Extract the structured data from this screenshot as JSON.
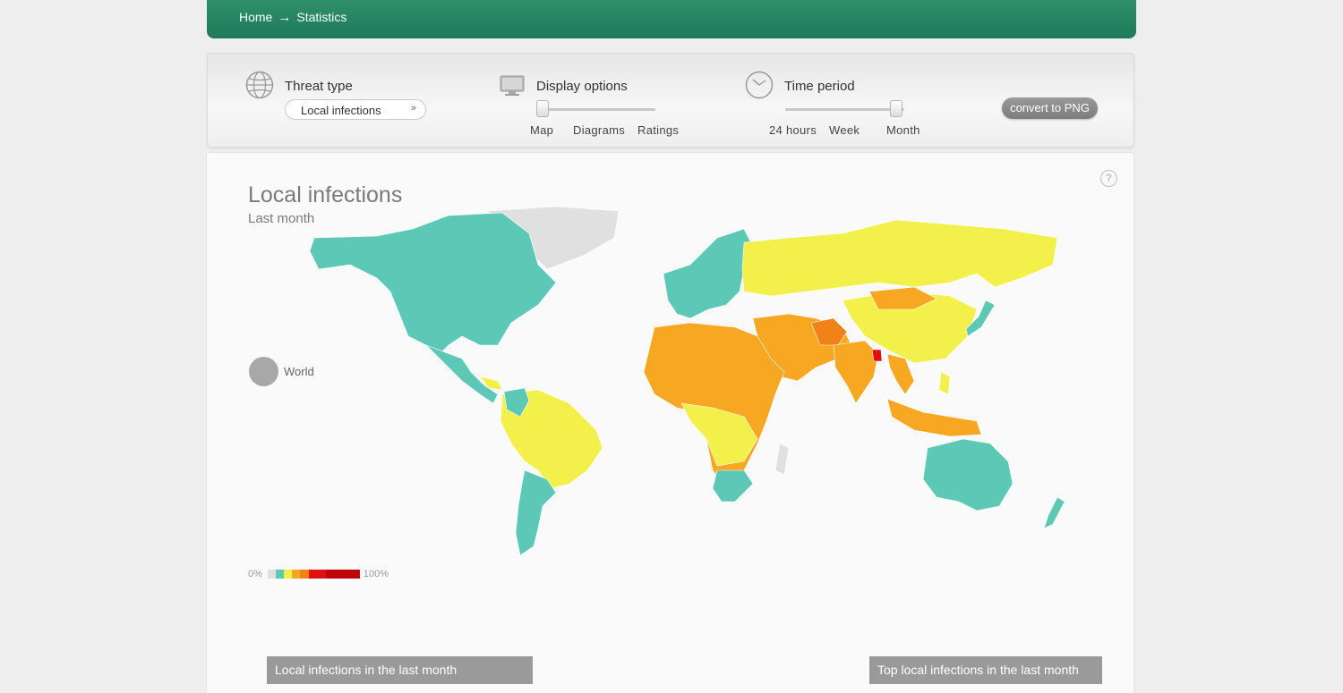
{
  "breadcrumb": {
    "home": "Home",
    "arrow": "→",
    "current": "Statistics"
  },
  "controls": {
    "threat_type": {
      "title": "Threat type",
      "selected": "Local infections",
      "icon": "globe-icon"
    },
    "display_options": {
      "title": "Display options",
      "icon": "monitor-icon",
      "options": [
        "Map",
        "Diagrams",
        "Ratings"
      ],
      "selected": "Map"
    },
    "time_period": {
      "title": "Time period",
      "icon": "clock-icon",
      "options": [
        "24 hours",
        "Week",
        "Month"
      ],
      "selected": "Month"
    },
    "convert_button": "convert to PNG"
  },
  "map": {
    "title": "Local infections",
    "subtitle": "Last month",
    "world_label": "World",
    "legend": {
      "min_label": "0%",
      "max_label": "100%",
      "colors": [
        "#e0e0e0",
        "#5cc8b5",
        "#f3ef4b",
        "#f8a722",
        "#f08218",
        "#e01010",
        "#c0000a"
      ]
    },
    "colors": {
      "no_data": "#e0e0e0",
      "low": "#5cc8b5",
      "medium": "#f3ef4b",
      "high": "#f8a722",
      "higher": "#f08218",
      "highest": "#e01010"
    }
  },
  "sections": {
    "left": "Local infections in the last month",
    "right": "Top local infections in the last month"
  }
}
